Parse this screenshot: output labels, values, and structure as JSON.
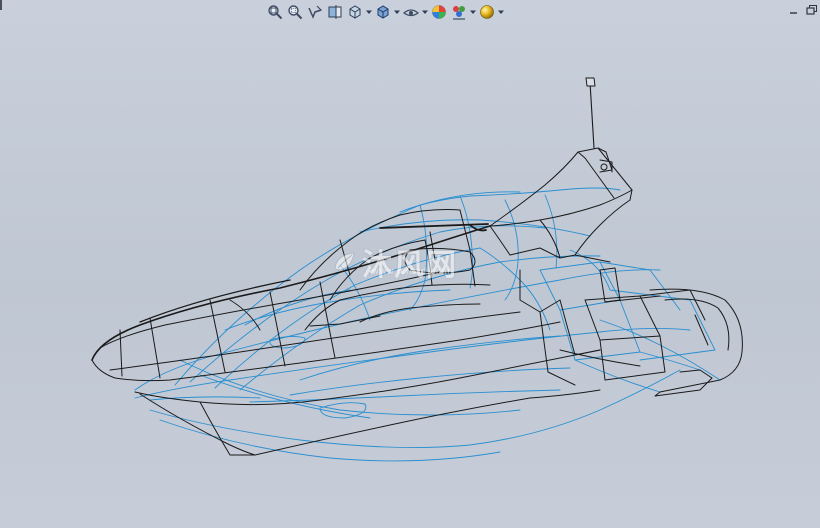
{
  "window": {
    "background_color": "#c4cbd7"
  },
  "toolbar": {
    "items": [
      {
        "icon": "zoom-to-fit-icon"
      },
      {
        "icon": "zoom-to-area-icon"
      },
      {
        "icon": "previous-view-icon"
      },
      {
        "icon": "section-view-icon"
      },
      {
        "icon": "view-orientation-icon",
        "dropdown": true
      },
      {
        "icon": "display-style-icon",
        "dropdown": true
      },
      {
        "icon": "hide-show-items-icon",
        "dropdown": true
      },
      {
        "icon": "edit-appearance-icon"
      },
      {
        "icon": "apply-scene-icon",
        "dropdown": true
      },
      {
        "icon": "view-settings-icon",
        "dropdown": true
      }
    ]
  },
  "window_controls": {
    "minimize_icon": "minimize-icon",
    "restore_icon": "restore-icon"
  },
  "watermark": {
    "text": "沐风网",
    "url": "www.mfcad.com"
  },
  "model": {
    "edge_color": "#1a1a1a",
    "hidden_edge_color": "#2a8fd0"
  }
}
